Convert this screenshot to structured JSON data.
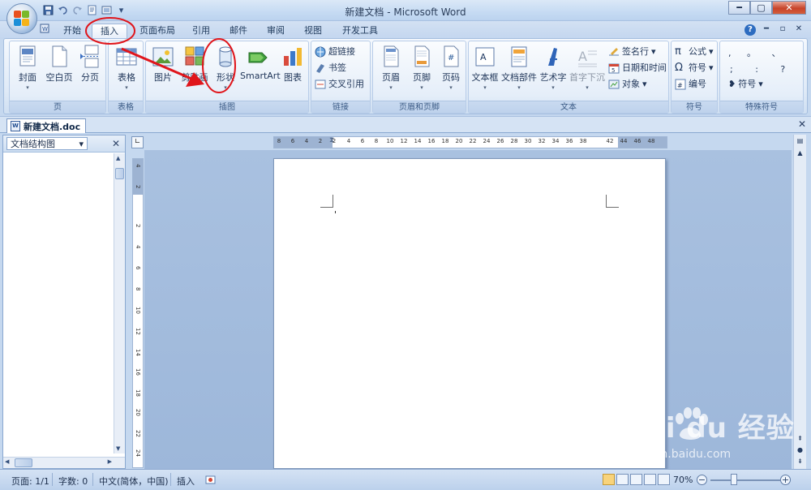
{
  "window": {
    "title": "新建文档 - Microsoft Word",
    "controls": {
      "minimize": "━",
      "maximize": "▢",
      "close": "✕"
    }
  },
  "quick_access": [
    "save-icon",
    "undo-icon",
    "redo-icon",
    "open-icon",
    "print-preview-icon",
    "customize-dropdown-icon"
  ],
  "tabs": [
    {
      "label": "开始"
    },
    {
      "label": "插入",
      "active": true
    },
    {
      "label": "页面布局"
    },
    {
      "label": "引用"
    },
    {
      "label": "邮件"
    },
    {
      "label": "审阅"
    },
    {
      "label": "视图"
    },
    {
      "label": "开发工具"
    }
  ],
  "ribbon": {
    "pages": {
      "label": "页",
      "cover": "封面",
      "blank": "空白页",
      "break": "分页"
    },
    "tables": {
      "label": "表格",
      "table": "表格"
    },
    "illustrations": {
      "label": "插图",
      "picture": "图片",
      "clipart": "剪贴画",
      "shapes": "形状",
      "smartart": "SmartArt",
      "chart": "图表"
    },
    "links": {
      "label": "链接",
      "hyperlink": "超链接",
      "bookmark": "书签",
      "crossref": "交叉引用"
    },
    "header_footer": {
      "label": "页眉和页脚",
      "header": "页眉",
      "footer": "页脚",
      "page_number": "页码"
    },
    "text": {
      "label": "文本",
      "textbox": "文本框",
      "quickparts": "文档部件",
      "wordart": "艺术字",
      "dropcap": "首字下沉",
      "signature": "签名行",
      "datetime": "日期和时间",
      "object": "对象"
    },
    "symbols": {
      "label": "符号",
      "equation": "公式",
      "symbol": "符号",
      "number": "编号"
    },
    "special": {
      "label": "特殊符号",
      "symbols_row1": ", 。 、",
      "symbols_row2": "; : ?",
      "more": "符号"
    }
  },
  "document_tab": {
    "name": "新建文档.doc"
  },
  "nav_pane": {
    "title": "文档结构图"
  },
  "hruler_ticks": [
    "8",
    "6",
    "4",
    "2",
    "2",
    "4",
    "6",
    "8",
    "10",
    "12",
    "14",
    "16",
    "18",
    "20",
    "22",
    "24",
    "26",
    "28",
    "30",
    "32",
    "34",
    "36",
    "38",
    "42",
    "44",
    "46",
    "48"
  ],
  "vruler_ticks": [
    "4",
    "2",
    "2",
    "4",
    "6",
    "8",
    "10",
    "12",
    "14",
    "16",
    "18",
    "20",
    "22",
    "24"
  ],
  "status": {
    "page": "页面: 1/1",
    "words": "字数: 0",
    "language": "中文(简体，中国)",
    "mode": "插入",
    "zoom": "70%",
    "zoom_level": 0.7
  },
  "watermark": {
    "main": "Bai  du 经验",
    "sub": "jingyan.baidu.com"
  },
  "colors": {
    "annotation_red": "#e0151b",
    "ribbon_bg": "#dfeaf7",
    "workspace_bg": "#a9c1e0"
  }
}
